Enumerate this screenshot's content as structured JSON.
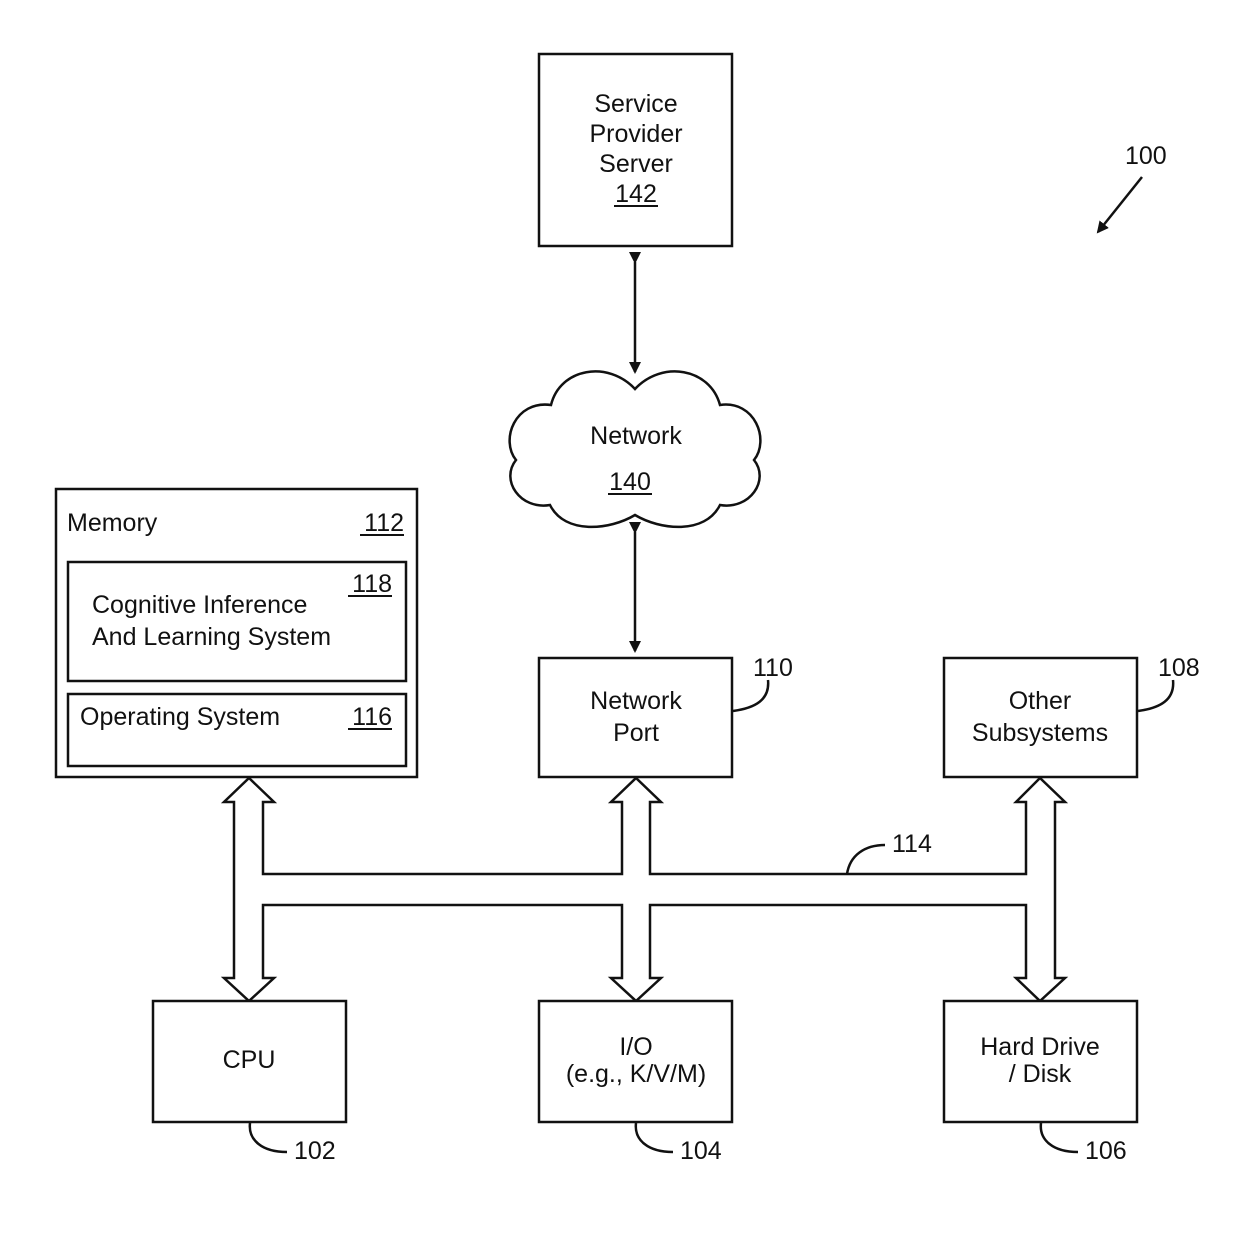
{
  "figure_ref": "100",
  "colors": {
    "ink": "#111111",
    "background": "#ffffff"
  },
  "nodes": {
    "server": {
      "lines": [
        "Service",
        "Provider",
        "Server"
      ],
      "ref": "142"
    },
    "network": {
      "label": "Network",
      "ref": "140"
    },
    "memory": {
      "label": "Memory",
      "ref": "112"
    },
    "cils": {
      "lines": [
        "Cognitive Inference",
        "And Learning System"
      ],
      "ref": "118"
    },
    "os": {
      "label": "Operating System",
      "ref": "116"
    },
    "network_port": {
      "lines": [
        "Network",
        "Port"
      ],
      "ref": "110"
    },
    "other_subsystems": {
      "lines": [
        "Other",
        "Subsystems"
      ],
      "ref": "108"
    },
    "cpu": {
      "label": "CPU",
      "ref": "102"
    },
    "io": {
      "lines": [
        "I/O",
        "(e.g., K/V/M)"
      ],
      "ref": "104"
    },
    "hard_drive": {
      "lines": [
        "Hard Drive",
        "/ Disk"
      ],
      "ref": "106"
    }
  },
  "bus": {
    "ref": "114"
  },
  "edges": [
    {
      "from": "server",
      "to": "network",
      "type": "bidirectional"
    },
    {
      "from": "network",
      "to": "network_port",
      "type": "bidirectional"
    },
    {
      "from": "memory",
      "to": "cpu",
      "type": "bus-bidirectional"
    },
    {
      "from": "network_port",
      "to": "io",
      "type": "bus-bidirectional"
    },
    {
      "from": "other_subsystems",
      "to": "hard_drive",
      "type": "bus-bidirectional"
    }
  ]
}
